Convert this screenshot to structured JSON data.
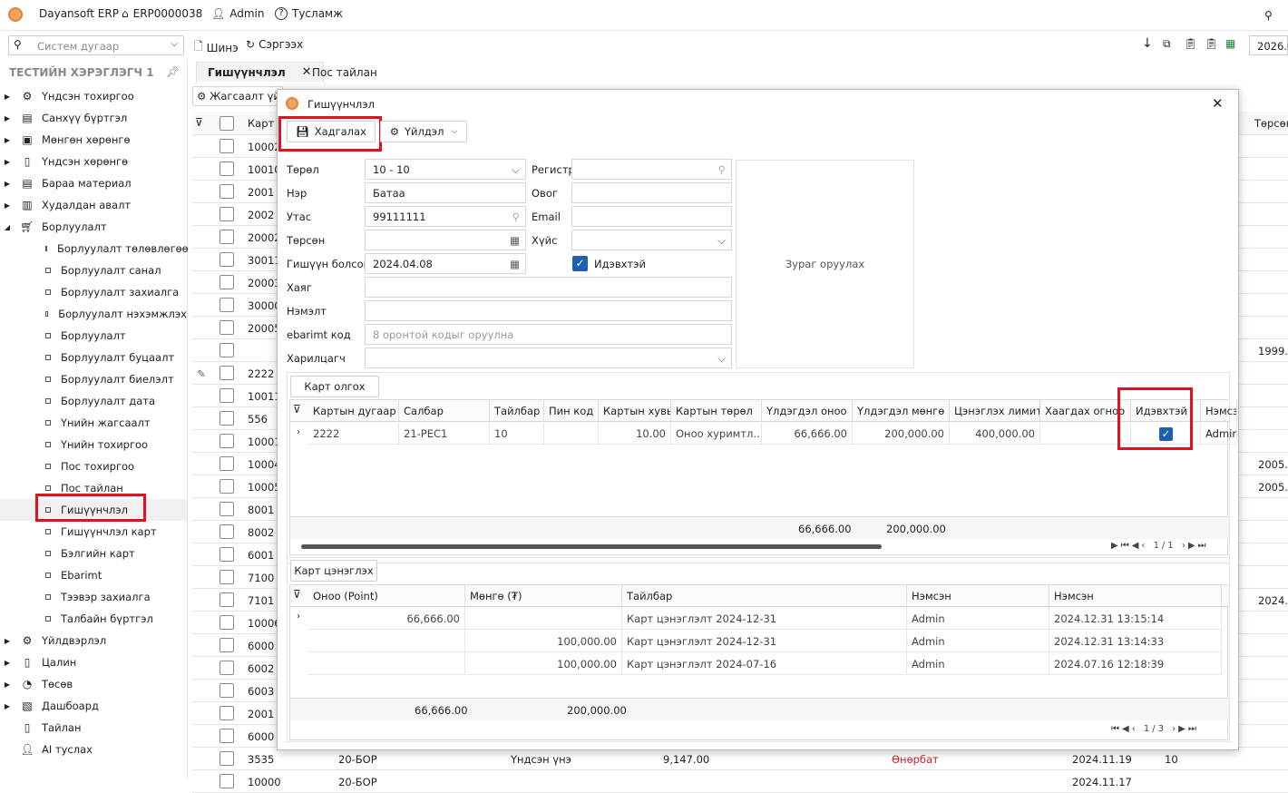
{
  "topbar": {
    "app": "Dayansoft ERP",
    "code": "ERP0000038",
    "user": "Admin",
    "help": "Тусламж"
  },
  "toolbar": {
    "search_placeholder": "Систем дугаар",
    "new": "Шинэ",
    "refresh": "Сэргээх",
    "date": "2026.0"
  },
  "sidebar": {
    "title": "ТЕСТИЙН ХЭРЭГЛЭГЧ 1",
    "top": [
      "Үндсэн тохиргоо",
      "Санхүү бүртгэл",
      "Мөнгөн хөрөнгө",
      "Үндсэн хөрөнгө",
      "Бараа материал",
      "Худалдан авалт",
      "Борлуулалт"
    ],
    "sub": [
      "Борлуулалт төлөвлөгөө",
      "Борлуулалт санал",
      "Борлуулалт захиалга",
      "Борлуулалт нэхэмжлэх",
      "Борлуулалт",
      "Борлуулалт буцаалт",
      "Борлуулалт биелэлт",
      "Борлуулалт дата",
      "Үнийн жагсаалт",
      "Үнийн тохиргоо",
      "Пос тохиргоо",
      "Пос тайлан",
      "Гишүүнчлэл",
      "Гишүүнчлэл карт",
      "Бэлгийн карт",
      "Ebarimt",
      "Тээвэр захиалга",
      "Талбайн бүртгэл"
    ],
    "bottom": [
      "Үйлдвэрлэл",
      "Цалин",
      "Төсөв",
      "Дашбоард",
      "Тайлан",
      "AI туслах"
    ]
  },
  "tabs": [
    "Гишүүнчлэл",
    "Пос тайлан"
  ],
  "bg": {
    "tool": "Жагсаалт үй",
    "col_card": "Карт",
    "col_torson": "Төрсөн",
    "rows": [
      "10002",
      "10010",
      "2001",
      "2002",
      "20002",
      "30011",
      "20003",
      "30000",
      "20005",
      "",
      "2222",
      "10011",
      "556",
      "10001",
      "10004",
      "10005",
      "8001",
      "8002",
      "6001",
      "7100",
      "7101",
      "10006",
      "6000",
      "6002",
      "6003",
      "2001",
      "6000",
      "3535",
      "10000"
    ],
    "dates": {
      "9": "1999.1",
      "14": "2005.0",
      "15": "2005.0",
      "20": "2024.0"
    },
    "last": {
      "a": "20-БОР",
      "b": "Үндсэн үнэ",
      "c": "9,147.00",
      "d": "Өнөрбат",
      "e": "2024.11.19",
      "f": "10"
    },
    "last2": {
      "a": "20-БОР",
      "e": "2024.11.17"
    }
  },
  "dialog": {
    "title": "Гишүүнчлэл",
    "save": "Хадгалах",
    "action": "Үйлдэл",
    "form": {
      "type_l": "Төрөл",
      "type_v": "10 - 10",
      "name_l": "Нэр",
      "name_v": "Батаа",
      "phone_l": "Утас",
      "phone_v": "99111111",
      "birth_l": "Төрсөн",
      "joined_l": "Гишүүн болсон",
      "joined_v": "2024.04.08",
      "addr_l": "Хаяг",
      "extra_l": "Нэмэлт",
      "ebarimt_l": "ebarimt код",
      "ebarimt_ph": "8 оронтой кодыг оруулна",
      "partner_l": "Харилцагч",
      "reg_l": "Регистр",
      "surname_l": "Овог",
      "email_l": "Email",
      "gender_l": "Хүйс",
      "active_l": "Идэвхтэй",
      "photo": "Зураг оруулах"
    },
    "cards": {
      "button": "Карт олгох",
      "headers": [
        "Картын дугаар",
        "Салбар",
        "Тайлбар",
        "Пин код",
        "Картын хувь",
        "Картын төрөл",
        "Үлдэгдэл оноо",
        "Үлдэгдэл мөнгө",
        "Цэнэглэх лимит",
        "Хаагдах огноо",
        "Идэвхтэй",
        "Нэмсэн"
      ],
      "row": [
        "2222",
        "21-PEC1",
        "10",
        "",
        "10.00",
        "Оноо хуримтл...",
        "66,666.00",
        "200,000.00",
        "400,000.00",
        "",
        "",
        "Admin"
      ],
      "sum1": "66,666.00",
      "sum2": "200,000.00",
      "page": "1/1"
    },
    "recharge": {
      "button": "Карт цэнэглэх",
      "headers": [
        "Оноо (Point)",
        "Мөнгө (₮)",
        "Тайлбар",
        "Нэмсэн",
        "Нэмсэн"
      ],
      "rows": [
        [
          "66,666.00",
          "",
          "Карт цэнэглэлт 2024-12-31",
          "Admin",
          "2024.12.31 13:15:14"
        ],
        [
          "",
          "100,000.00",
          "Карт цэнэглэлт 2024-12-31",
          "Admin",
          "2024.12.31 13:14:33"
        ],
        [
          "",
          "100,000.00",
          "Карт цэнэглэлт 2024-07-16",
          "Admin",
          "2024.07.16 12:18:39"
        ]
      ],
      "sum1": "66,666.00",
      "sum2": "200,000.00",
      "page": "1/3"
    }
  }
}
